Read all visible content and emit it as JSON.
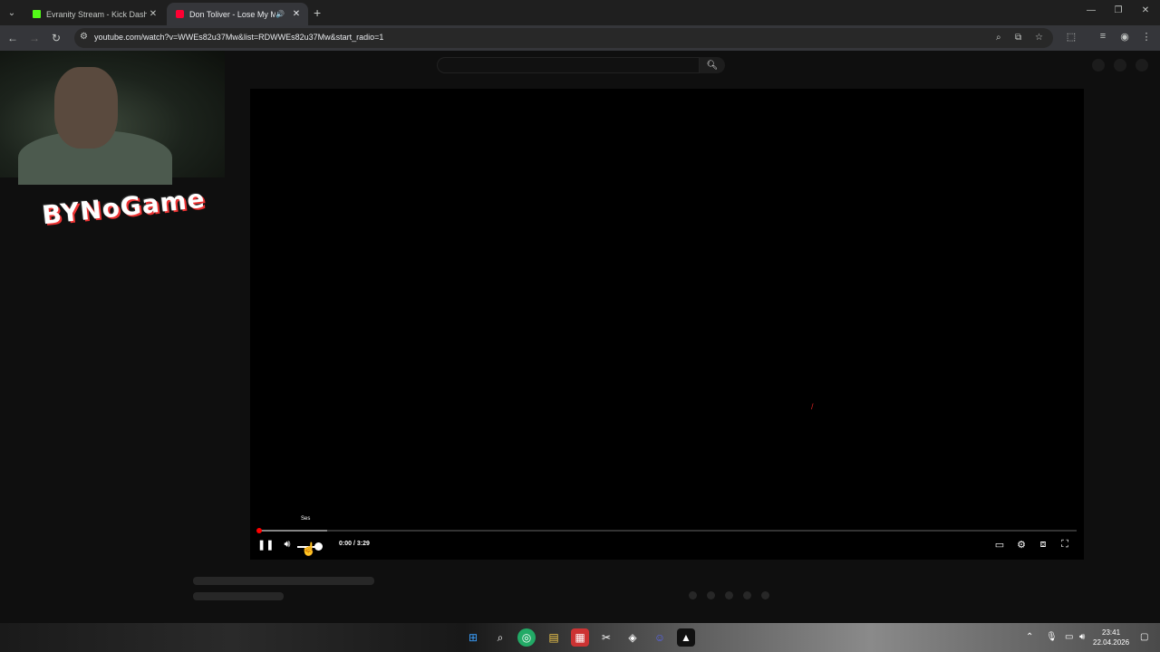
{
  "browser": {
    "tabs": [
      {
        "title": "Evranity Stream - Kick Dashboard",
        "active": false,
        "favicon_color": "#53fc18"
      },
      {
        "title": "Don Toliver - Lose My Mind",
        "active": true,
        "favicon_color": "#ff0033"
      }
    ],
    "url": "youtube.com/watch?v=WWEs82u37Mw&list=RDWWEs82u37Mw&start_radio=1"
  },
  "player": {
    "tooltip": "Ses",
    "time_current": "0:00",
    "time_separator": " / ",
    "time_total": "3:29",
    "progress_fraction": 0.0,
    "buffer_fraction": 0.085,
    "volume_fraction": 1.0,
    "accent_color": "#ff0000"
  },
  "overlay": {
    "logo_text": "BYNoGame"
  },
  "taskbar": {
    "time": "23:41",
    "date": "22.04.2026"
  }
}
